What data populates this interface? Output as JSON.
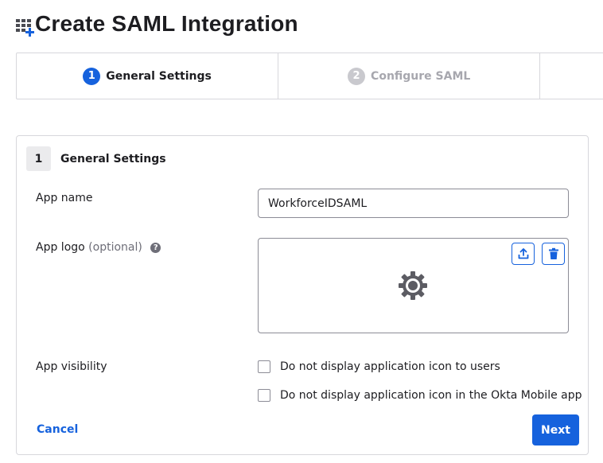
{
  "page": {
    "title": "Create SAML Integration"
  },
  "stepper": {
    "steps": [
      {
        "number": "1",
        "label": "General Settings",
        "state": "active"
      },
      {
        "number": "2",
        "label": "Configure SAML",
        "state": "inactive"
      }
    ]
  },
  "section": {
    "number": "1",
    "title": "General Settings"
  },
  "fields": {
    "app_name": {
      "label": "App name",
      "value": "WorkforceIDSAML"
    },
    "app_logo": {
      "label": "App logo",
      "optional": "(optional)",
      "help": "?"
    },
    "app_visibility": {
      "label": "App visibility",
      "options": [
        {
          "label": "Do not display application icon to users",
          "checked": false
        },
        {
          "label": "Do not display application icon in the Okta Mobile app",
          "checked": false
        }
      ]
    }
  },
  "actions": {
    "cancel": "Cancel",
    "next": "Next"
  },
  "icons": {
    "title_icon": "add-app-grid-icon",
    "upload": "upload-icon",
    "delete": "trash-icon",
    "logo_placeholder": "gear-icon",
    "help": "help-icon"
  },
  "colors": {
    "accent": "#1662dd",
    "inactive_step": "#c9c9ce",
    "border": "#d7d7dc"
  }
}
